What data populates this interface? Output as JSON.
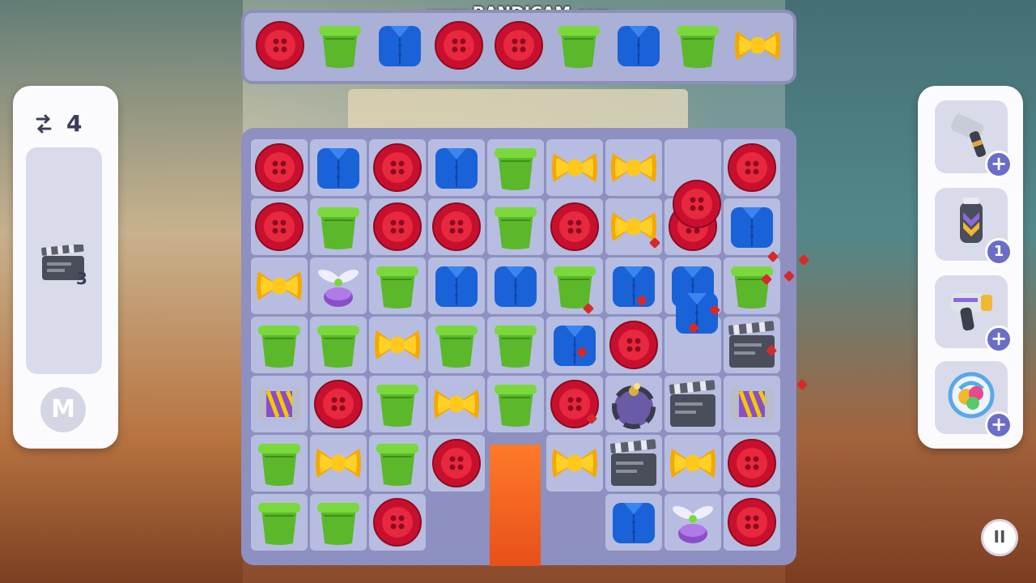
{
  "watermark": {
    "prefix": "www.",
    "brand": "BANDICAM",
    "suffix": ".com"
  },
  "goals": [
    "button",
    "bucket",
    "shirt",
    "button",
    "button",
    "bucket",
    "shirt",
    "bucket",
    "bow"
  ],
  "hud": {
    "moves": "4",
    "task_count": "3",
    "badge": "M"
  },
  "boosters": [
    {
      "name": "hammer",
      "badge": "+"
    },
    {
      "name": "rocket",
      "badge": "1"
    },
    {
      "name": "hairdryer",
      "badge": "+"
    },
    {
      "name": "shuffle",
      "badge": "+"
    }
  ],
  "pause": "II",
  "board": {
    "rows": [
      [
        "button",
        "shirt",
        "button",
        "shirt",
        "bucket",
        "bow",
        "bow",
        "empty",
        "button"
      ],
      [
        "button",
        "bucket",
        "button",
        "button",
        "bucket",
        "button",
        "bow",
        "button",
        "shirt"
      ],
      [
        "bow",
        "propeller",
        "bucket",
        "shirt",
        "shirt",
        "bucket",
        "shirt",
        "shirt",
        "bucket"
      ],
      [
        "bucket",
        "bucket",
        "bow",
        "bucket",
        "bucket",
        "shirt",
        "button",
        "empty",
        "clapper"
      ],
      [
        "roller",
        "button",
        "bucket",
        "bow",
        "bucket",
        "button",
        "bomb",
        "clapper",
        "roller"
      ],
      [
        "bucket",
        "bow",
        "bucket",
        "button",
        "none",
        "bow",
        "clapper",
        "bow",
        "button"
      ],
      [
        "bucket",
        "bucket",
        "button",
        "none",
        "none",
        "none",
        "shirt",
        "propeller",
        "button"
      ]
    ]
  }
}
